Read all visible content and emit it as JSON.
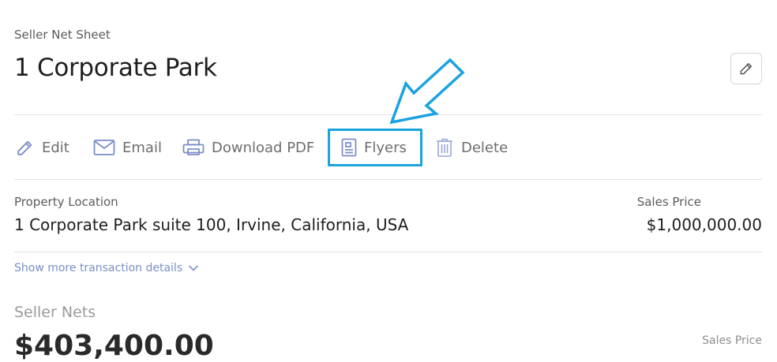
{
  "header": {
    "subtitle": "Seller Net Sheet",
    "title": "1 Corporate Park",
    "edit_icon": "pencil-icon"
  },
  "actions": [
    {
      "label": "Edit",
      "icon": "pencil-icon"
    },
    {
      "label": "Email",
      "icon": "envelope-icon"
    },
    {
      "label": "Download PDF",
      "icon": "printer-icon"
    },
    {
      "label": "Flyers",
      "icon": "document-icon"
    },
    {
      "label": "Delete",
      "icon": "trash-icon"
    }
  ],
  "property": {
    "location_label": "Property Location",
    "location_value": "1 Corporate Park suite 100, Irvine, California, USA",
    "price_label": "Sales Price",
    "price_value": "$1,000,000.00"
  },
  "more_details": {
    "label": "Show more transaction details",
    "icon": "chevron-down-icon"
  },
  "seller_nets": {
    "title": "Seller Nets",
    "amount": "$403,400.00",
    "sales_price_label": "Sales Price"
  },
  "colors": {
    "accent_blue": "#1aa3e0",
    "icon_blue": "#7b8fc7",
    "link_blue": "#7b8fc7"
  },
  "annotation": {
    "arrow_icon": "arrow-down-left-icon",
    "highlight_target": "Flyers"
  }
}
